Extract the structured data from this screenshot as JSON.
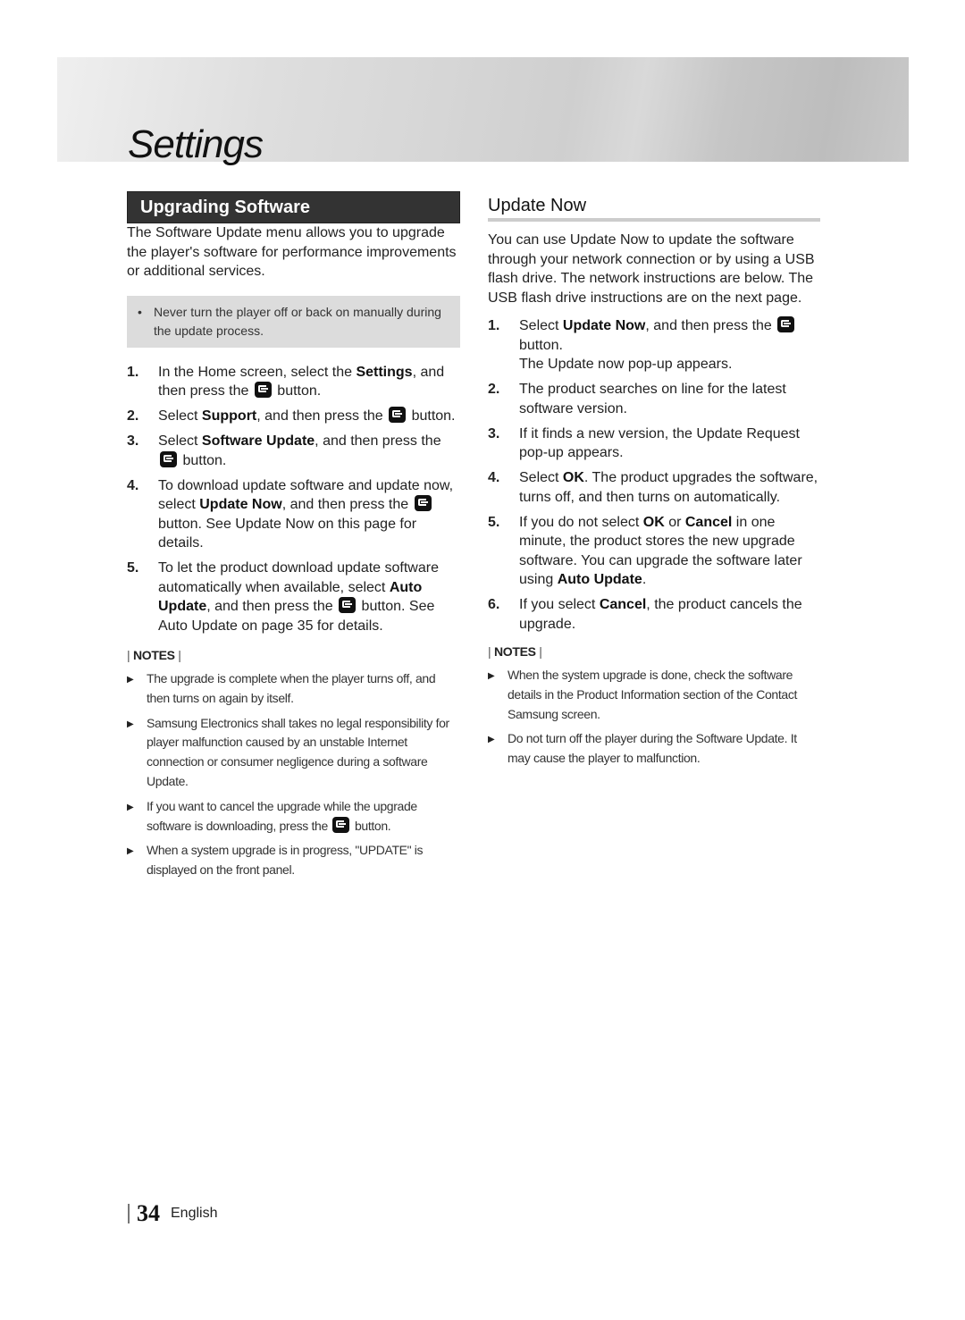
{
  "banner": {
    "title": "Settings"
  },
  "left": {
    "heading": "Upgrading Software",
    "intro": "The Software Update menu allows you to upgrade the player's software for performance improvements or additional services.",
    "warning": "Never turn the player off or back on manually during the update process.",
    "steps": [
      {
        "num": "1.",
        "parts": [
          {
            "t": "In the Home screen, select the "
          },
          {
            "b": "Settings"
          },
          {
            "t": ", and then press the "
          },
          {
            "icon": "enter"
          },
          {
            "t": " button."
          }
        ]
      },
      {
        "num": "2.",
        "parts": [
          {
            "t": "Select "
          },
          {
            "b": "Support"
          },
          {
            "t": ", and then press the "
          },
          {
            "icon": "enter"
          },
          {
            "t": " button."
          }
        ]
      },
      {
        "num": "3.",
        "parts": [
          {
            "t": "Select "
          },
          {
            "b": "Software Update"
          },
          {
            "t": ", and then press the "
          },
          {
            "icon": "enter"
          },
          {
            "t": " button."
          }
        ]
      },
      {
        "num": "4.",
        "parts": [
          {
            "t": "To download update software and update now, select "
          },
          {
            "b": "Update Now"
          },
          {
            "t": ", and then press the "
          },
          {
            "icon": "enter"
          },
          {
            "t": " button. See Update Now on this page for details."
          }
        ]
      },
      {
        "num": "5.",
        "parts": [
          {
            "t": "To let the product download update software automatically when available, select "
          },
          {
            "b": "Auto Update"
          },
          {
            "t": ", and then press the "
          },
          {
            "icon": "enter"
          },
          {
            "t": " button. See Auto Update on page 35 for details."
          }
        ]
      }
    ],
    "notes_label": "NOTES",
    "notes": [
      {
        "parts": [
          {
            "t": "The upgrade is complete when the player turns off, and then turns on again by itself."
          }
        ]
      },
      {
        "parts": [
          {
            "t": "Samsung Electronics shall takes no legal responsibility for player malfunction caused by an unstable Internet connection or consumer negligence during a software Update."
          }
        ]
      },
      {
        "parts": [
          {
            "t": "If you want to cancel the upgrade while the upgrade software is downloading, press the "
          },
          {
            "icon": "enter"
          },
          {
            "t": " button."
          }
        ]
      },
      {
        "parts": [
          {
            "t": "When a system upgrade is in progress, \"UPDATE\" is displayed on the front panel."
          }
        ]
      }
    ]
  },
  "right": {
    "heading": "Update Now",
    "intro": "You can use Update Now to update the software through your network connection or by using a USB flash drive. The network instructions are below. The USB flash drive instructions are on the next page.",
    "steps": [
      {
        "num": "1.",
        "parts": [
          {
            "t": "Select "
          },
          {
            "b": "Update Now"
          },
          {
            "t": ", and then press the "
          },
          {
            "icon": "enter"
          },
          {
            "t": " button."
          },
          {
            "br": true
          },
          {
            "t": "The Update now pop-up appears."
          }
        ]
      },
      {
        "num": "2.",
        "parts": [
          {
            "t": "The product searches on line for the latest software version."
          }
        ]
      },
      {
        "num": "3.",
        "parts": [
          {
            "t": "If it finds a new version, the Update Request pop-up appears."
          }
        ]
      },
      {
        "num": "4.",
        "parts": [
          {
            "t": "Select "
          },
          {
            "b": "OK"
          },
          {
            "t": ". The product upgrades the software, turns off, and then turns on automatically."
          }
        ]
      },
      {
        "num": "5.",
        "parts": [
          {
            "t": "If you do not select "
          },
          {
            "b": "OK"
          },
          {
            "t": " or "
          },
          {
            "b": "Cancel"
          },
          {
            "t": " in one minute, the product stores the new upgrade software. You can upgrade the software later using "
          },
          {
            "b": "Auto Update"
          },
          {
            "t": "."
          }
        ]
      },
      {
        "num": "6.",
        "parts": [
          {
            "t": "If you select "
          },
          {
            "b": "Cancel"
          },
          {
            "t": ", the product cancels the upgrade."
          }
        ]
      }
    ],
    "notes_label": "NOTES",
    "notes": [
      {
        "parts": [
          {
            "t": "When the system upgrade is done, check the software details in the Product Information section of the Contact Samsung screen."
          }
        ]
      },
      {
        "parts": [
          {
            "t": "Do not turn off the player during the Software Update. It may cause the player to malfunction."
          }
        ]
      }
    ]
  },
  "footer": {
    "page_number": "34",
    "language": "English"
  }
}
